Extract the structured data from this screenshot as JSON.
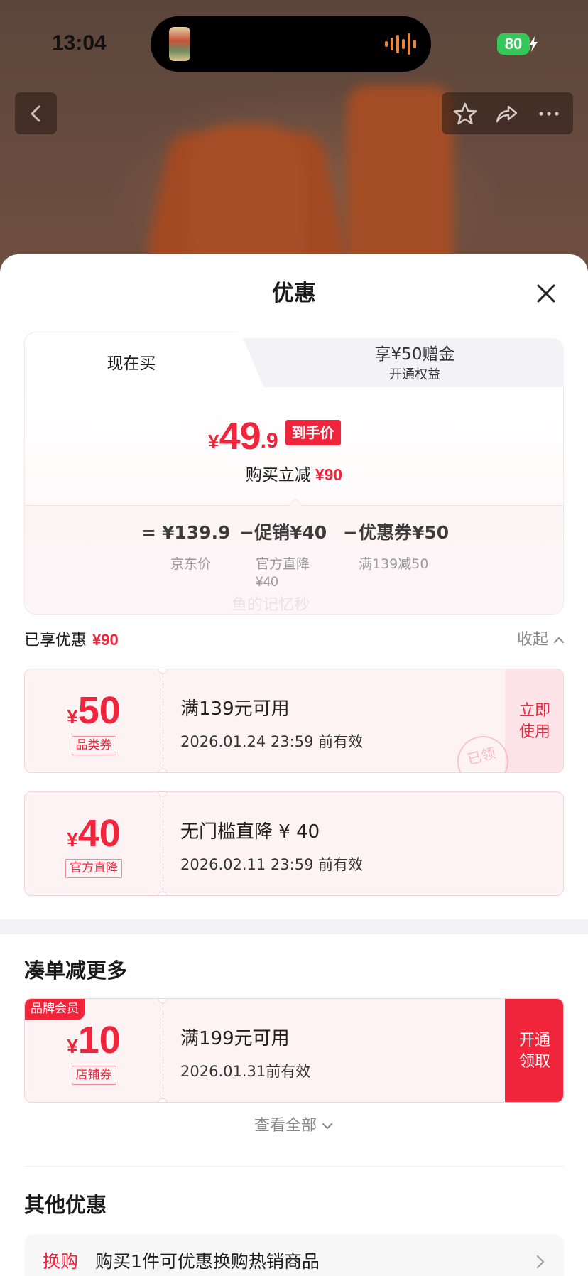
{
  "status_bar": {
    "time": "13:04",
    "battery_level": "80",
    "icons": {
      "charging": "bolt-icon",
      "audio": "waveform-icon",
      "now_playing": "album-art-icon"
    }
  },
  "top_nav": {
    "icons": {
      "back": "chevron-left-icon",
      "favorite": "star-icon",
      "share": "share-icon",
      "more": "more-dots-icon"
    }
  },
  "sheet": {
    "title": "优惠",
    "close_icon": "close-icon"
  },
  "price_card": {
    "tabs": [
      {
        "label": "现在买",
        "active": true
      },
      {
        "label": "享¥50赠金",
        "sublabel": "开通权益",
        "active": false
      }
    ],
    "price": {
      "currency": "¥",
      "integer": "49",
      "decimal": ".9",
      "badge": "到手价"
    },
    "saving": {
      "label": "购买立减",
      "value": "¥90"
    },
    "formula": {
      "equals": "=",
      "operator": "−",
      "items": [
        {
          "value": "¥139.9",
          "note": "京东价"
        },
        {
          "value": "促销¥40",
          "note_line1": "官方直降",
          "note_line2": "¥40"
        },
        {
          "value": "优惠券¥50",
          "note": "满139减50"
        }
      ]
    }
  },
  "watermark": "鱼的记忆秒",
  "enjoyed": {
    "label": "已享优惠",
    "value": "¥90",
    "toggle": "收起"
  },
  "coupons": [
    {
      "currency": "¥",
      "amount": "50",
      "type": "品类券",
      "condition": "满139元可用",
      "validity": "2026.01.24 23:59 前有效",
      "action_line1": "立即",
      "action_line2": "使用",
      "stamp": "已领"
    },
    {
      "currency": "¥",
      "amount": "40",
      "type": "官方直降",
      "condition": "无门槛直降 ¥ 40",
      "validity": "2026.02.11 23:59 前有效"
    }
  ],
  "more_deals": {
    "title": "凑单减更多",
    "coupons": [
      {
        "corner_tag": "品牌会员",
        "currency": "¥",
        "amount": "10",
        "type": "店铺券",
        "condition": "满199元可用",
        "validity": "2026.01.31前有效",
        "action_line1": "开通",
        "action_line2": "领取"
      }
    ],
    "view_all": "查看全部"
  },
  "other_deals": {
    "title": "其他优惠",
    "items": [
      {
        "tag": "换购",
        "text": "购买1件可优惠换购热销商品"
      }
    ]
  },
  "colors": {
    "accent_red": "#f0243b",
    "coupon_bg": "#fdf3f5",
    "coupon_border": "#f5d3d9",
    "battery_green": "#34c759",
    "text_dark": "#1a1a1a",
    "text_muted": "#8a8a8a"
  }
}
